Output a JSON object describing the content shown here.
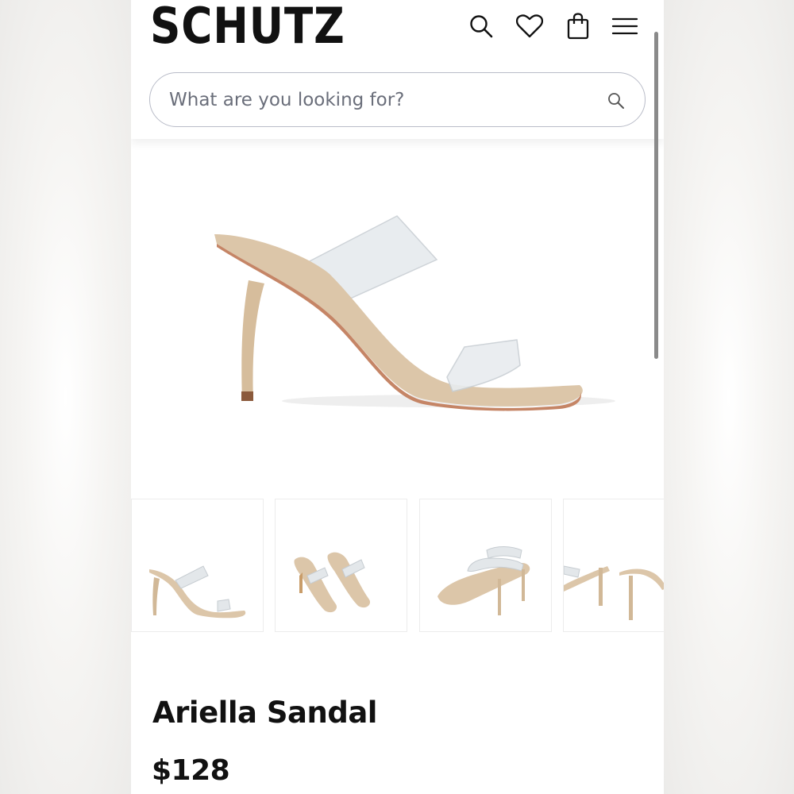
{
  "brand": {
    "logo_text": "SCHUTZ"
  },
  "header": {
    "icons": [
      "search-icon",
      "heart-icon",
      "shopping-bag-icon",
      "menu-icon"
    ]
  },
  "search": {
    "placeholder": "What are you looking for?",
    "value": ""
  },
  "gallery": {
    "main_image": "sandal-side-view",
    "thumbnails": [
      "sandal-side-view",
      "sandal-pair-top-view",
      "sandal-pair-angled-view",
      "sandal-heels-rear-view"
    ]
  },
  "product": {
    "name": "Ariella Sandal",
    "price": "$128"
  },
  "colors": {
    "suede": "#d9c3a6",
    "sole": "#c8876a",
    "vinyl": "#dfe3e6",
    "text": "#111111"
  }
}
